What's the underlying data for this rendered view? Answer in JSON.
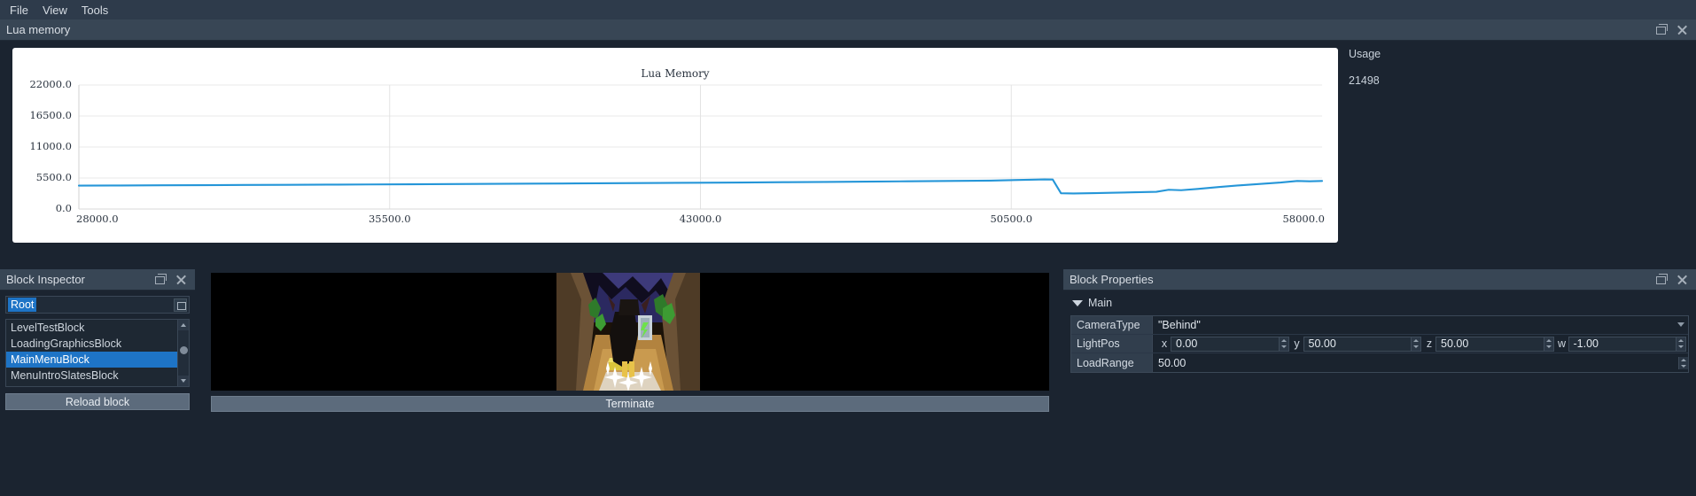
{
  "menubar": {
    "items": [
      {
        "label": "File"
      },
      {
        "label": "View"
      },
      {
        "label": "Tools"
      }
    ]
  },
  "lua_panel": {
    "title": "Lua memory",
    "usage_label": "Usage",
    "usage_value": "21498"
  },
  "chart_data": {
    "type": "line",
    "title": "Lua Memory",
    "xlabel": "",
    "ylabel": "",
    "xlim": [
      28000.0,
      58000.0
    ],
    "ylim": [
      0.0,
      22000.0
    ],
    "xticks": [
      "28000.0",
      "35500.0",
      "43000.0",
      "50500.0",
      "58000.0"
    ],
    "yticks": [
      "22000.0",
      "16500.0",
      "11000.0",
      "5500.0",
      "0.0"
    ],
    "grid": true,
    "legend": false,
    "series": [
      {
        "name": "Lua Memory",
        "color": "#2596d8",
        "x": [
          28000,
          29000,
          30000,
          31000,
          32000,
          33000,
          34000,
          35000,
          36000,
          37000,
          38000,
          39000,
          40000,
          41000,
          42000,
          43000,
          44000,
          45000,
          46000,
          47000,
          48000,
          49000,
          50000,
          50800,
          51300,
          51500,
          51700,
          52000,
          52500,
          53000,
          53500,
          54000,
          54300,
          54600,
          55000,
          55500,
          56000,
          56500,
          57000,
          57400,
          57700,
          58000
        ],
        "values": [
          4150,
          4180,
          4210,
          4240,
          4270,
          4300,
          4330,
          4360,
          4395,
          4430,
          4465,
          4500,
          4540,
          4580,
          4620,
          4665,
          4710,
          4760,
          4810,
          4865,
          4920,
          4980,
          5040,
          5180,
          5260,
          5230,
          2800,
          2760,
          2820,
          2900,
          2980,
          3060,
          3420,
          3340,
          3560,
          3900,
          4200,
          4450,
          4700,
          4980,
          4920,
          4980
        ]
      }
    ]
  },
  "inspector": {
    "title": "Block Inspector",
    "path_value": "Root",
    "path_button": "browse-icon",
    "items": [
      {
        "label": "LevelTestBlock",
        "selected": false
      },
      {
        "label": "LoadingGraphicsBlock",
        "selected": false
      },
      {
        "label": "MainMenuBlock",
        "selected": true
      },
      {
        "label": "MenuIntroSlatesBlock",
        "selected": false
      }
    ],
    "reload_label": "Reload block"
  },
  "viewport": {
    "terminate_label": "Terminate"
  },
  "properties": {
    "title": "Block Properties",
    "group_label": "Main",
    "rows": [
      {
        "name": "CameraType",
        "type": "combo",
        "value": "\"Behind\""
      },
      {
        "name": "LightPos",
        "type": "vector",
        "components": [
          {
            "axis": "x",
            "value": "0.00"
          },
          {
            "axis": "y",
            "value": "50.00"
          },
          {
            "axis": "z",
            "value": "50.00"
          },
          {
            "axis": "w",
            "value": "-1.00"
          }
        ]
      },
      {
        "name": "LoadRange",
        "type": "spin",
        "value": "50.00"
      }
    ]
  },
  "colors": {
    "accent": "#1e74c6",
    "chart_line": "#2596d8",
    "panel_bg": "#1b2430",
    "titlebar": "#384655"
  }
}
